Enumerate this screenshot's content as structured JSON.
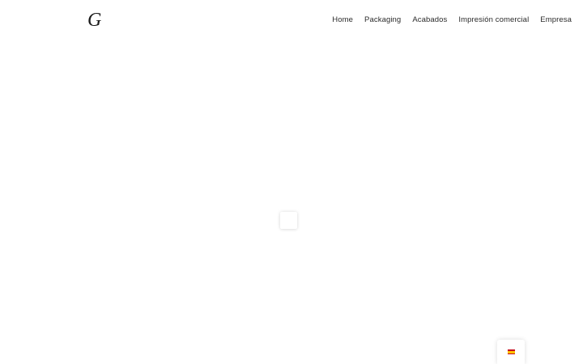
{
  "header": {
    "logo_text": "G",
    "nav": [
      {
        "label": "Home"
      },
      {
        "label": "Packaging"
      },
      {
        "label": "Acabados"
      },
      {
        "label": "Impresión comercial"
      },
      {
        "label": "Empresa"
      }
    ]
  },
  "language_switcher": {
    "flag_icon": "spain-flag-icon",
    "colors": {
      "red": "#c60b1e",
      "yellow": "#ffc400"
    }
  },
  "loader": {
    "icon": "loading-spinner-icon"
  }
}
